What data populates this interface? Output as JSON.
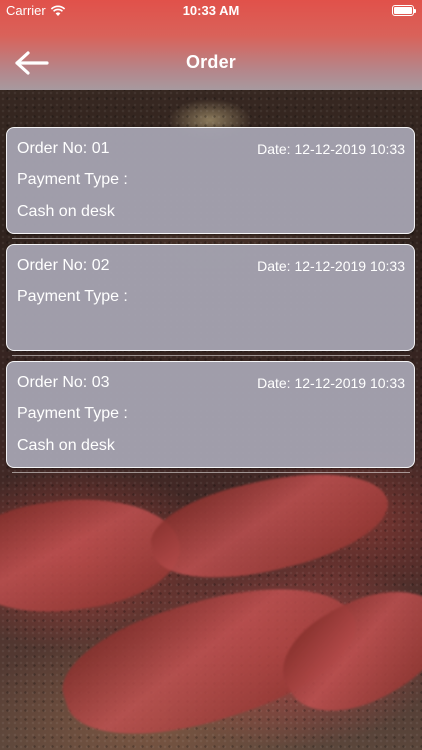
{
  "status_bar": {
    "carrier": "Carrier",
    "time": "10:33 AM",
    "icons": [
      "wifi-icon",
      "battery-icon"
    ]
  },
  "nav": {
    "title": "Order",
    "back_icon": "arrow-left-icon",
    "colors": {
      "top": "#e1514a",
      "bottom": "#a7999f"
    }
  },
  "orders": [
    {
      "order_no": "Order No: 01",
      "date": "Date: 12-12-2019 10:33",
      "payment_label": "Payment Type :",
      "payment_value": "Cash on desk"
    },
    {
      "order_no": "Order No: 02",
      "date": "Date: 12-12-2019 10:33",
      "payment_label": "Payment Type :",
      "payment_value": ""
    },
    {
      "order_no": "Order No: 03",
      "date": "Date: 12-12-2019 10:33",
      "payment_label": "Payment Type :",
      "payment_value": "Cash on desk"
    }
  ],
  "colors": {
    "card_background": "#a4a2b0",
    "card_border": "#f4f4f6",
    "text": "#ffffff"
  }
}
